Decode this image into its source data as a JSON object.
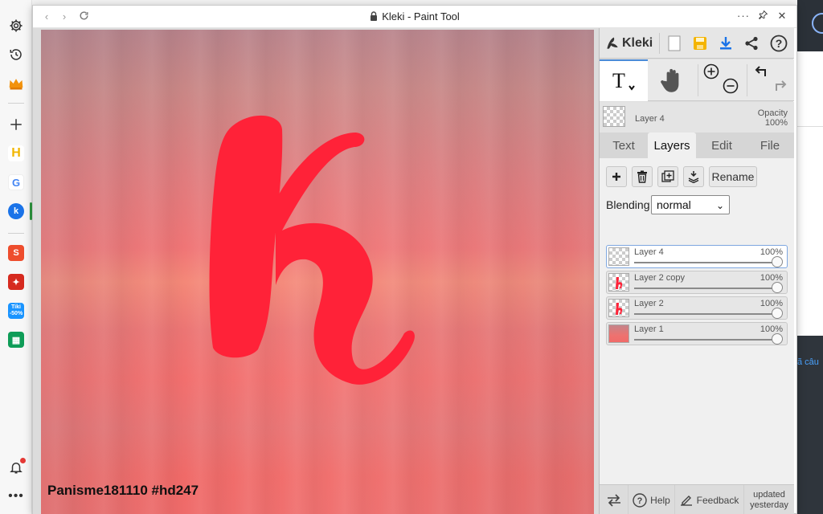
{
  "window": {
    "title": "Kleki - Paint Tool"
  },
  "canvas": {
    "watermark": "Panisme181110 #hd247",
    "letter_color": "#ff2238"
  },
  "panel": {
    "logo": "Kleki",
    "current_layer": "Layer 4",
    "opacity_label": "Opacity",
    "opacity_value": "100%",
    "tabs": [
      {
        "label": "Text"
      },
      {
        "label": "Layers"
      },
      {
        "label": "Edit"
      },
      {
        "label": "File"
      }
    ],
    "active_tab": "Layers",
    "rename_label": "Rename",
    "blending_label": "Blending",
    "blending_value": "normal",
    "layers": [
      {
        "name": "Layer 4",
        "opacity": "100%",
        "selected": true
      },
      {
        "name": "Layer 2 copy",
        "opacity": "100%",
        "selected": false
      },
      {
        "name": "Layer 2",
        "opacity": "100%",
        "selected": false
      },
      {
        "name": "Layer 1",
        "opacity": "100%",
        "selected": false
      }
    ],
    "footer": {
      "help": "Help",
      "feedback": "Feedback",
      "updated_line1": "updated",
      "updated_line2": "yesterday"
    }
  },
  "background_page": {
    "snippet": "ã câu"
  },
  "colors": {
    "accent": "#4a8bd8",
    "download_icon": "#1a73e8",
    "save_icon": "#f4b400"
  }
}
